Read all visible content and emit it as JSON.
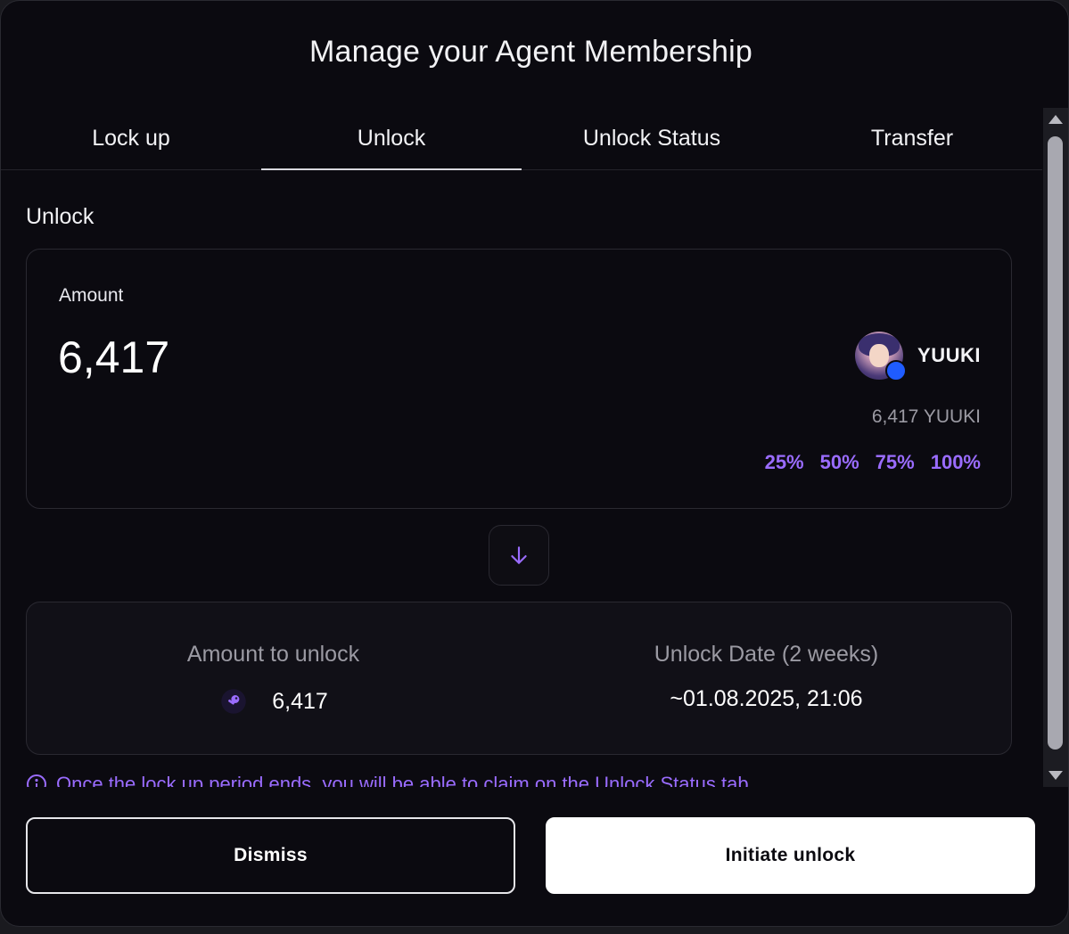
{
  "modal": {
    "title": "Manage your Agent Membership"
  },
  "tabs": [
    {
      "label": "Lock up",
      "active": false
    },
    {
      "label": "Unlock",
      "active": true
    },
    {
      "label": "Unlock Status",
      "active": false
    },
    {
      "label": "Transfer",
      "active": false
    }
  ],
  "section": {
    "label": "Unlock"
  },
  "amount_card": {
    "label": "Amount",
    "value": "6,417",
    "token_name": "YUUKI",
    "balance": "6,417 YUUKI",
    "percent_options": [
      "25%",
      "50%",
      "75%",
      "100%"
    ]
  },
  "unlock_summary": {
    "amount_label": "Amount to unlock",
    "amount_value": "6,417",
    "date_label": "Unlock Date (2 weeks)",
    "date_value": "~01.08.2025, 21:06"
  },
  "info_note": "Once the lock up period ends, you will be able to claim on the Unlock Status tab",
  "actions": {
    "dismiss_label": "Dismiss",
    "primary_label": "Initiate unlock"
  },
  "colors": {
    "accent": "#9a6cff",
    "background": "#0b0a10",
    "muted_text": "#9b9aa3",
    "token_badge": "#1f5cff"
  },
  "icons": {
    "swap": "arrow-down-icon",
    "amount": "key-icon",
    "info": "info-circle-icon"
  }
}
